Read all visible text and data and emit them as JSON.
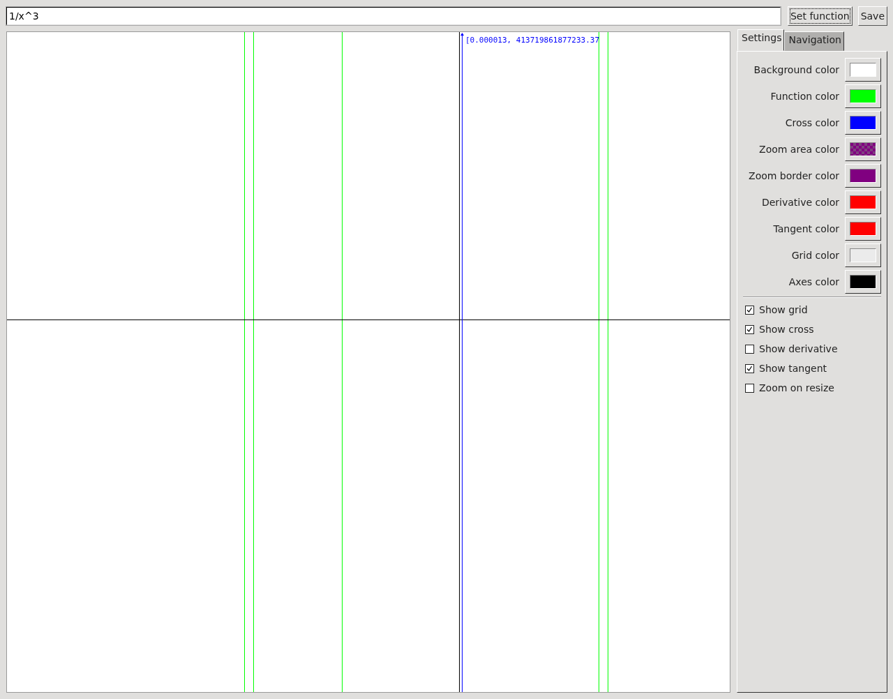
{
  "function_field": {
    "value": "1/x^3"
  },
  "buttons": [
    {
      "label": "Set function",
      "focused": true
    },
    {
      "label": "Save",
      "focused": false
    }
  ],
  "plot": {
    "cross_label": "[0.000013, 413719861877233.37"
  },
  "tabs": [
    {
      "label": "Settings",
      "selected": true
    },
    {
      "label": "Navigation",
      "selected": false
    }
  ],
  "color_settings": [
    {
      "label": "Background color",
      "color": "#ffffff",
      "checkered": false
    },
    {
      "label": "Function color",
      "color": "#00ff00",
      "checkered": false
    },
    {
      "label": "Cross color",
      "color": "#0000ff",
      "checkered": false
    },
    {
      "label": "Zoom area color",
      "color": "#800080",
      "checkered": true
    },
    {
      "label": "Zoom border color",
      "color": "#800080",
      "checkered": false
    },
    {
      "label": "Derivative color",
      "color": "#ff0000",
      "checkered": false
    },
    {
      "label": "Tangent color",
      "color": "#ff0000",
      "checkered": false
    },
    {
      "label": "Grid color",
      "color": "#ebebeb",
      "checkered": false
    },
    {
      "label": "Axes color",
      "color": "#000000",
      "checkered": false
    }
  ],
  "options": [
    {
      "label": "Show grid",
      "checked": true
    },
    {
      "label": "Show cross",
      "checked": true
    },
    {
      "label": "Show derivative",
      "checked": false
    },
    {
      "label": "Show tangent",
      "checked": true
    },
    {
      "label": "Zoom on resize",
      "checked": false
    }
  ]
}
